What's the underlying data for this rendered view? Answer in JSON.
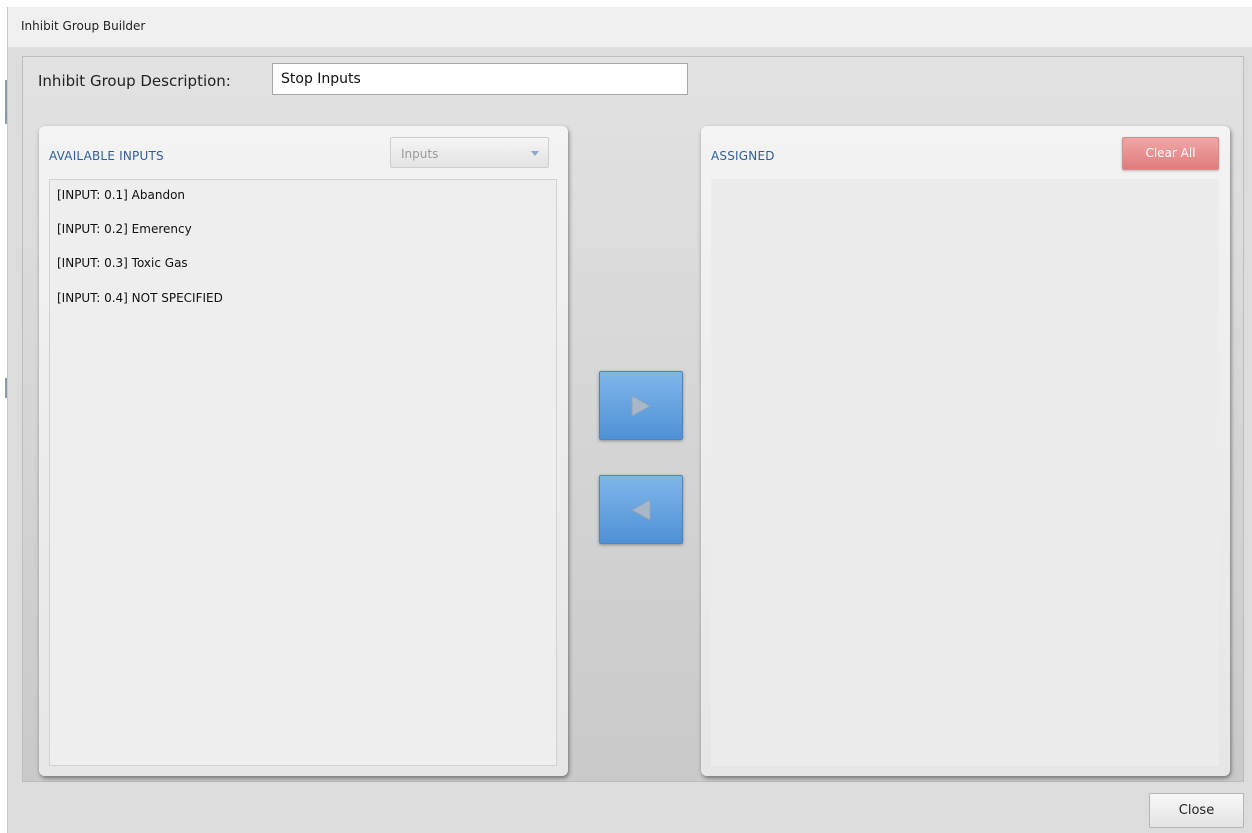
{
  "window": {
    "title": "Inhibit Group Builder"
  },
  "description": {
    "label": "Inhibit Group Description:",
    "value": "Stop Inputs"
  },
  "available": {
    "title": "AVAILABLE INPUTS",
    "filter_selected": "Inputs",
    "items": [
      {
        "label": "[INPUT: 0.1] Abandon"
      },
      {
        "label": "[INPUT: 0.2] Emerency"
      },
      {
        "label": "[INPUT: 0.3] Toxic Gas"
      },
      {
        "label": "[INPUT: 0.4] NOT SPECIFIED"
      }
    ]
  },
  "assigned": {
    "title": "ASSIGNED",
    "clear_all_label": "Clear All",
    "items": []
  },
  "transfer": {
    "add_icon": "play-right-icon",
    "remove_icon": "play-left-icon"
  },
  "footer": {
    "close_label": "Close"
  },
  "colors": {
    "section_title": "#2f5f97",
    "transfer_button": "#5b9ddf",
    "clear_all_button": "#e58888"
  }
}
